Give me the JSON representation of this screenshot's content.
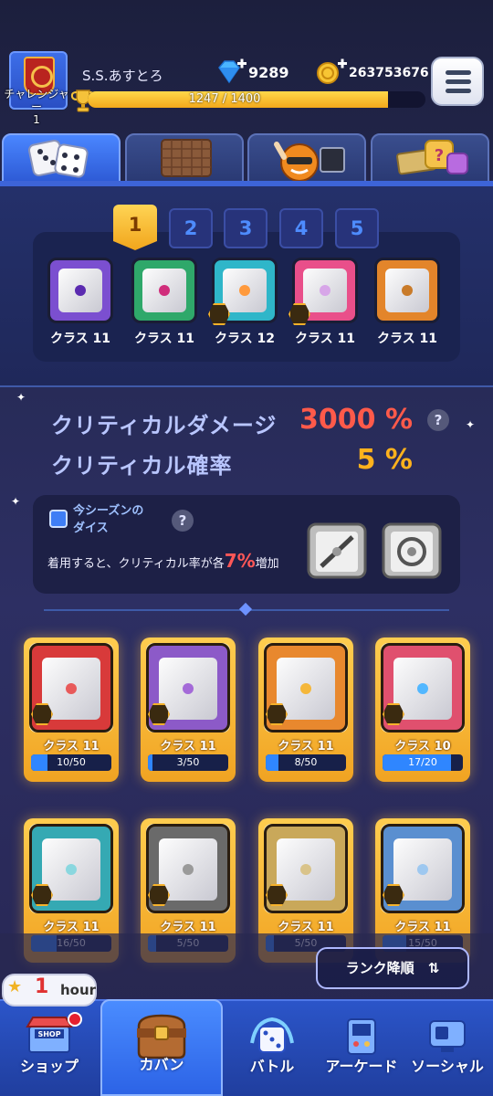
{
  "header": {
    "player_name": "S.S.あすとろ",
    "rank_title": "チャレンジャー",
    "rank_level": "1",
    "xp_text": "1247 / 1400",
    "xp_progress": 0.89,
    "gems": "9289",
    "coins": "263753676",
    "icons": {
      "avatar": "banner-emblem-icon",
      "trophy": "trophy-icon",
      "gem": "gem-icon",
      "coin": "coin-icon",
      "menu": "hamburger-menu-icon"
    }
  },
  "category_tabs": [
    {
      "name": "dice",
      "icon": "dice-icon",
      "active": true
    },
    {
      "name": "board",
      "icon": "board-icon",
      "active": false
    },
    {
      "name": "character",
      "icon": "character-icon",
      "active": false
    },
    {
      "name": "emote",
      "icon": "emote-icon",
      "active": false
    }
  ],
  "deck": {
    "tabs": [
      "1",
      "2",
      "3",
      "4",
      "5"
    ],
    "active_tab": "1",
    "dice": [
      {
        "label": "クラス 11",
        "color": "#7b4fd0",
        "pip": "#5b2bb0"
      },
      {
        "label": "クラス 11",
        "color": "#2fa86a",
        "pip": "#d02d7b"
      },
      {
        "label": "クラス 12",
        "color": "#2fb6c9",
        "pip": "#ff9a3d"
      },
      {
        "label": "クラス 11",
        "color": "#e94f8a",
        "pip": "#d7a6e8"
      },
      {
        "label": "クラス 11",
        "color": "#e3852a",
        "pip": "#c97b2a"
      }
    ]
  },
  "stats": {
    "crit_damage_label": "クリティカルダメージ",
    "crit_damage_value": "3000 %",
    "crit_rate_label": "クリティカル確率",
    "crit_rate_value": "5 %",
    "help": "?"
  },
  "season": {
    "title_line1": "今シーズンの",
    "title_line2": "ダイス",
    "desc_before": "着用すると、クリティカル率が各",
    "desc_pct": "7%",
    "desc_after": "増加",
    "help": "?"
  },
  "cards": [
    {
      "label": "クラス 11",
      "progress": "10/50",
      "ratio": 0.2,
      "color": "#d83a3a",
      "pip": "#e85a5a"
    },
    {
      "label": "クラス 11",
      "progress": "3/50",
      "ratio": 0.06,
      "color": "#8c5ac8",
      "pip": "#a46ad8"
    },
    {
      "label": "クラス 11",
      "progress": "8/50",
      "ratio": 0.16,
      "color": "#e8882e",
      "pip": "#f5b73a"
    },
    {
      "label": "クラス 10",
      "progress": "17/20",
      "ratio": 0.85,
      "color": "#e0506e",
      "pip": "#52b7ff"
    },
    {
      "label": "クラス 11",
      "progress": "16/50",
      "ratio": 0.32,
      "color": "#35a9b3",
      "pip": "#8ad7df"
    },
    {
      "label": "クラス 11",
      "progress": "5/50",
      "ratio": 0.1,
      "color": "#6a6a6a",
      "pip": "#9a9a9a"
    },
    {
      "label": "クラス 11",
      "progress": "5/50",
      "ratio": 0.1,
      "color": "#c9a85a",
      "pip": "#d9c38a"
    },
    {
      "label": "クラス 11",
      "progress": "15/50",
      "ratio": 0.3,
      "color": "#5a8fd0",
      "pip": "#9ec8f0"
    }
  ],
  "sort_button": {
    "label": "ランク降順",
    "icon": "sort-arrows-icon"
  },
  "shop_timer": {
    "value": "1",
    "unit": "hour"
  },
  "bottom_nav": [
    {
      "label": "ショップ",
      "icon": "shop-icon",
      "badge": "SHOP"
    },
    {
      "label": "カバン",
      "icon": "bag-icon",
      "active": true
    },
    {
      "label": "バトル",
      "icon": "battle-dice-icon"
    },
    {
      "label": "アーケード",
      "icon": "arcade-icon"
    },
    {
      "label": "ソーシャル",
      "icon": "social-icon"
    }
  ]
}
